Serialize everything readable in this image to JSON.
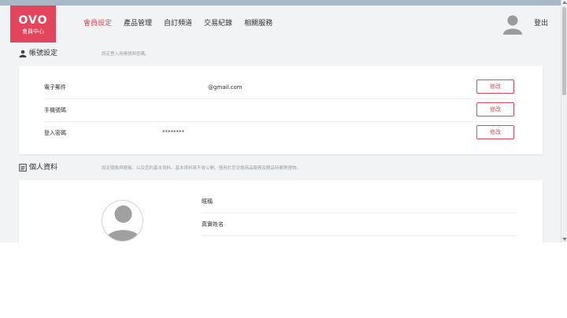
{
  "logo": {
    "mark": "OVO",
    "subtitle": "會員中心"
  },
  "nav": {
    "items": [
      {
        "label": "會員設定",
        "active": true
      },
      {
        "label": "產品管理"
      },
      {
        "label": "自訂頻道"
      },
      {
        "label": "交易紀錄"
      },
      {
        "label": "相關服務"
      }
    ],
    "logout": "登出"
  },
  "account": {
    "title": "帳號設定",
    "desc": "設定登入用帳號與密碼。",
    "rows": [
      {
        "label": "電子郵件",
        "value": "@gmail.com",
        "button": "修改"
      },
      {
        "label": "手機號碼",
        "value": "",
        "button": "修改"
      },
      {
        "label": "登入密碼",
        "value": "********",
        "button": "修改"
      }
    ]
  },
  "profile": {
    "title": "個人資料",
    "desc": "設定頭像與暱稱，以及您的基本資料。基本資料將不會公開，僅用於您兌換商品服務及贈品時郵寄禮物。",
    "fields": [
      {
        "label": "暱稱"
      },
      {
        "label": "真實姓名"
      }
    ]
  },
  "colors": {
    "accent": "#e3465c",
    "background": "#f2f3f5"
  }
}
